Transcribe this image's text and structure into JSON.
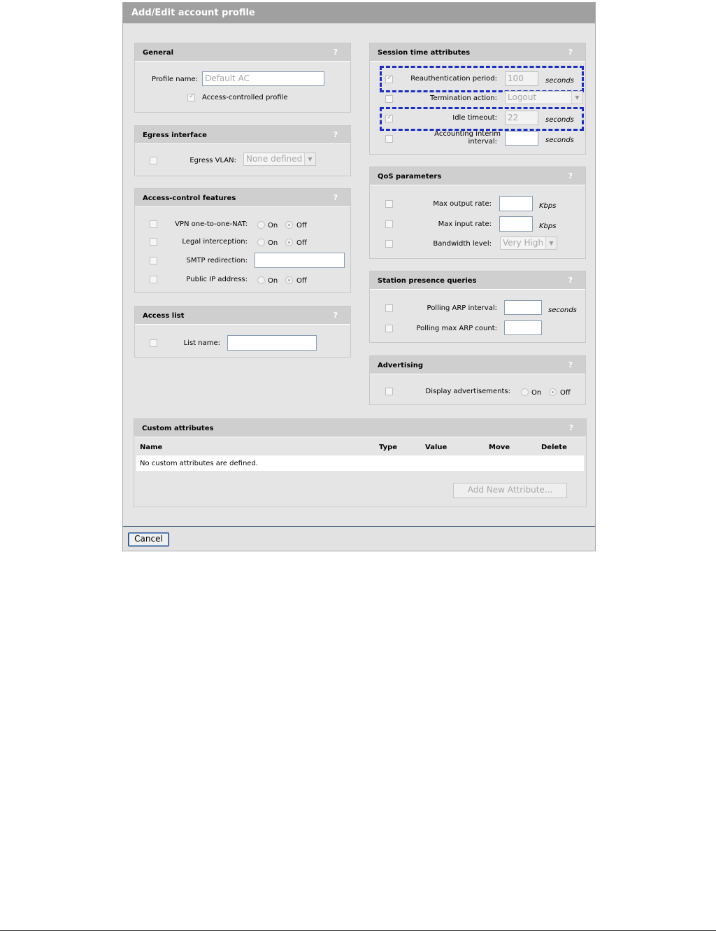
{
  "dialog": {
    "title": "Add/Edit account profile",
    "cancel_label": "Cancel"
  },
  "help_glyph": "?",
  "general": {
    "title": "General",
    "profile_name_label": "Profile name:",
    "profile_name_value": "Default AC",
    "access_controlled_label": "Access-controlled profile",
    "access_controlled_checked": true
  },
  "egress": {
    "title": "Egress interface",
    "vlan_label": "Egress VLAN:",
    "vlan_value": "None defined"
  },
  "access_control": {
    "title": "Access-control features",
    "on_label": "On",
    "off_label": "Off",
    "vpn_label": "VPN one-to-one-NAT:",
    "legal_label": "Legal interception:",
    "smtp_label": "SMTP redirection:",
    "smtp_value": "",
    "public_ip_label": "Public IP address:"
  },
  "access_list": {
    "title": "Access list",
    "list_name_label": "List name:",
    "list_name_value": ""
  },
  "session": {
    "title": "Session time attributes",
    "reauth_label": "Reauthentication period:",
    "reauth_value": "100",
    "termination_label": "Termination action:",
    "termination_value": "Logout",
    "idle_label": "Idle timeout:",
    "idle_value": "22",
    "acct_label_1": "Accounting interim",
    "acct_label_2": "interval:",
    "acct_value": "",
    "unit": "seconds"
  },
  "qos": {
    "title": "QoS parameters",
    "max_output_label": "Max output rate:",
    "max_input_label": "Max input rate:",
    "bandwidth_label": "Bandwidth level:",
    "bandwidth_value": "Very High",
    "unit": "Kbps"
  },
  "station": {
    "title": "Station presence queries",
    "arp_interval_label": "Polling ARP interval:",
    "arp_count_label": "Polling max ARP count:",
    "unit": "seconds"
  },
  "advertising": {
    "title": "Advertising",
    "display_label": "Display advertisements:",
    "on_label": "On",
    "off_label": "Off"
  },
  "custom": {
    "title": "Custom attributes",
    "columns": [
      "Name",
      "Type",
      "Value",
      "Move",
      "Delete"
    ],
    "empty_message": "No custom attributes are defined.",
    "add_button": "Add New Attribute..."
  }
}
